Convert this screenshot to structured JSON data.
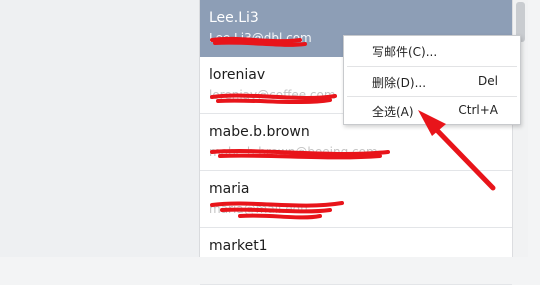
{
  "contacts": [
    {
      "name": "Lee.Li3",
      "email": "Lee.Li3@dbl.com"
    },
    {
      "name": "loreniav",
      "email": "loreniav@coffee.com"
    },
    {
      "name": "mabe.b.brown",
      "email": "mabe.b.brown@boeing.com"
    },
    {
      "name": "maria",
      "email": "maria@mail.edu"
    },
    {
      "name": "market1",
      "email": ""
    }
  ],
  "context_menu": {
    "compose": {
      "label": "写邮件(C)..."
    },
    "delete": {
      "label": "删除(D)...",
      "shortcut": "Del"
    },
    "select_all": {
      "label": "全选(A)",
      "shortcut": "Ctrl+A"
    }
  },
  "colors": {
    "selected_row": "#8d9eb6",
    "annotation_red": "#e8141a"
  }
}
